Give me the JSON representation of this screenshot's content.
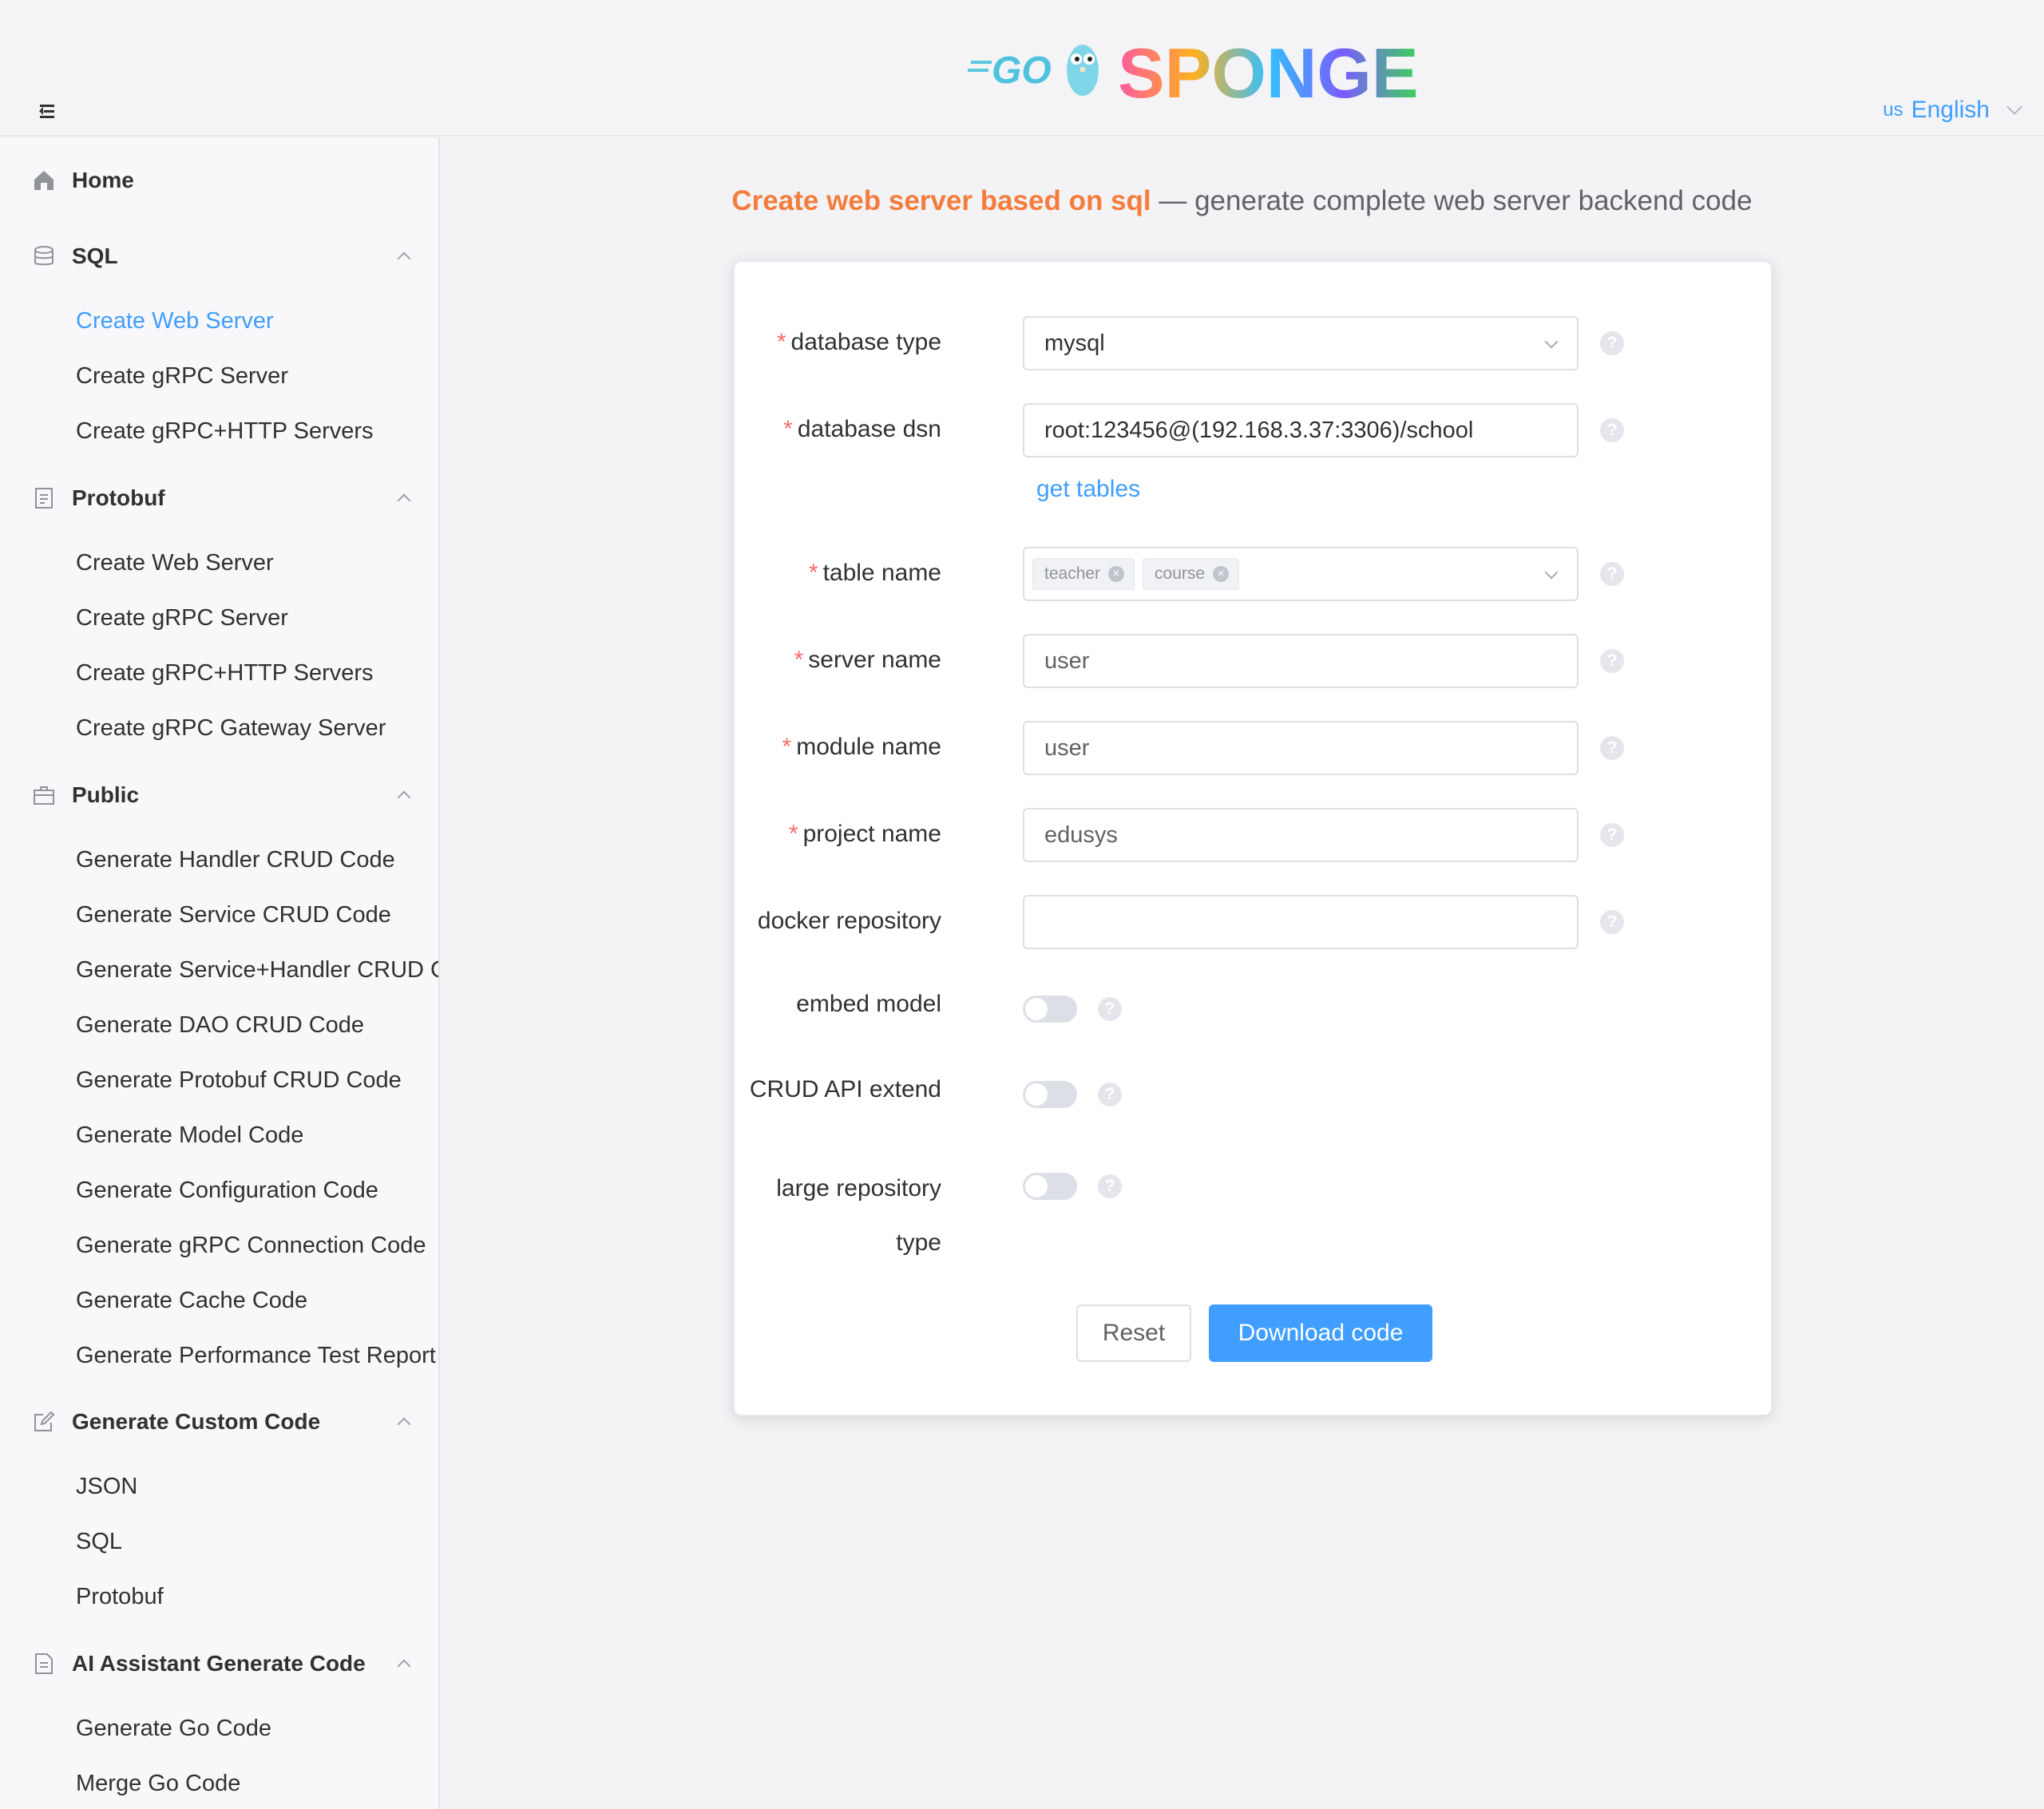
{
  "header": {
    "logo_go": "GO",
    "logo_sponge": "SPONGE",
    "language": {
      "flag": "us",
      "label": "English"
    }
  },
  "sidebar": {
    "groups": [
      {
        "title": "Home",
        "icon": "home-icon"
      },
      {
        "title": "SQL",
        "icon": "database-icon",
        "items": [
          "Create Web Server",
          "Create gRPC Server",
          "Create gRPC+HTTP Servers"
        ]
      },
      {
        "title": "Protobuf",
        "icon": "document-icon",
        "items": [
          "Create Web Server",
          "Create gRPC Server",
          "Create gRPC+HTTP Servers",
          "Create gRPC Gateway Server"
        ]
      },
      {
        "title": "Public",
        "icon": "briefcase-icon",
        "items": [
          "Generate Handler CRUD Code",
          "Generate Service CRUD Code",
          "Generate Service+Handler CRUD Code",
          "Generate DAO CRUD Code",
          "Generate Protobuf CRUD Code",
          "Generate Model Code",
          "Generate Configuration Code",
          "Generate gRPC Connection Code",
          "Generate Cache Code",
          "Generate Performance Test Report"
        ]
      },
      {
        "title": "Generate Custom Code",
        "icon": "edit-icon",
        "items": [
          "JSON",
          "SQL",
          "Protobuf"
        ]
      },
      {
        "title": "AI Assistant Generate Code",
        "icon": "document-icon",
        "items": [
          "Generate Go Code",
          "Merge Go Code"
        ]
      }
    ]
  },
  "page": {
    "title_highlight": "Create web server based on sql",
    "title_rest": " — generate complete web server backend code"
  },
  "form": {
    "database_type": {
      "label": "database type",
      "value": "mysql"
    },
    "database_dsn": {
      "label": "database dsn",
      "value": "root:123456@(192.168.3.37:3306)/school"
    },
    "get_tables": "get tables",
    "table_name": {
      "label": "table name",
      "tags": [
        "teacher",
        "course"
      ]
    },
    "server_name": {
      "label": "server name",
      "value": "user"
    },
    "module_name": {
      "label": "module name",
      "value": "user"
    },
    "project_name": {
      "label": "project name",
      "value": "edusys"
    },
    "docker_repository": {
      "label": "docker repository",
      "value": ""
    },
    "embed_model": {
      "label": "embed model",
      "on": false
    },
    "crud_api_extend": {
      "label": "CRUD API extend",
      "on": false
    },
    "large_repository_type": {
      "label_line1": "large repository",
      "label_line2": "type",
      "on": false
    },
    "help": "?",
    "reset_label": "Reset",
    "download_label": "Download code"
  },
  "colors": {
    "accent": "#409eff",
    "title_highlight": "#f47c3c",
    "required": "#f56c6c"
  }
}
